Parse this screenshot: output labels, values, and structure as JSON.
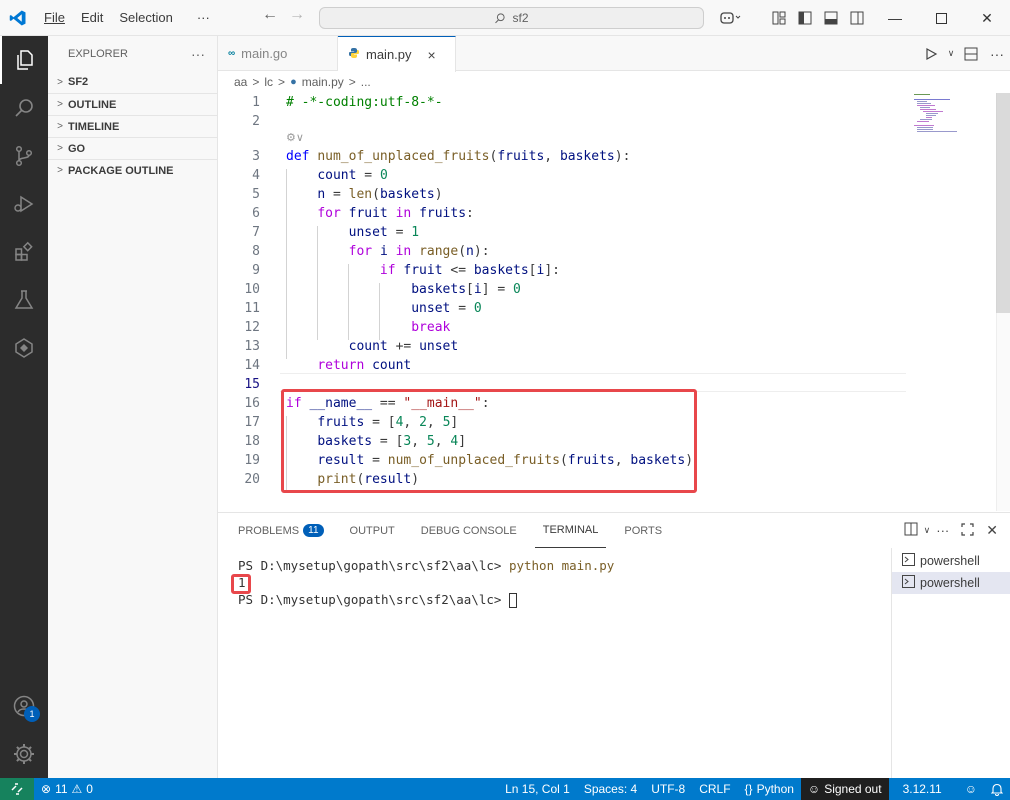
{
  "titlebar": {
    "menu": [
      "File",
      "Edit",
      "Selection"
    ],
    "more": "···",
    "search_text": "sf2"
  },
  "sidebar": {
    "title": "EXPLORER",
    "more": "···",
    "sections": [
      "SF2",
      "OUTLINE",
      "TIMELINE",
      "GO",
      "PACKAGE OUTLINE"
    ]
  },
  "tabs": [
    {
      "label": "main.go",
      "active": false
    },
    {
      "label": "main.py",
      "active": true,
      "close": "×"
    }
  ],
  "breadcrumb": [
    "aa",
    "lc",
    "main.py",
    "..."
  ],
  "editor": {
    "current_line": 15,
    "lines": [
      {
        "n": "1",
        "text": "# -*-coding:utf-8-*-"
      },
      {
        "n": "2",
        "text": ""
      },
      {
        "n": "3",
        "text": "def num_of_unplaced_fruits(fruits, baskets):"
      },
      {
        "n": "4",
        "text": "    count = 0"
      },
      {
        "n": "5",
        "text": "    n = len(baskets)"
      },
      {
        "n": "6",
        "text": "    for fruit in fruits:"
      },
      {
        "n": "7",
        "text": "        unset = 1"
      },
      {
        "n": "8",
        "text": "        for i in range(n):"
      },
      {
        "n": "9",
        "text": "            if fruit <= baskets[i]:"
      },
      {
        "n": "10",
        "text": "                baskets[i] = 0"
      },
      {
        "n": "11",
        "text": "                unset = 0"
      },
      {
        "n": "12",
        "text": "                break"
      },
      {
        "n": "13",
        "text": "        count += unset"
      },
      {
        "n": "14",
        "text": "    return count"
      },
      {
        "n": "15",
        "text": ""
      },
      {
        "n": "16",
        "text": "if __name__ == \"__main__\":"
      },
      {
        "n": "17",
        "text": "    fruits = [4, 2, 5]"
      },
      {
        "n": "18",
        "text": "    baskets = [3, 5, 4]"
      },
      {
        "n": "19",
        "text": "    result = num_of_unplaced_fruits(fruits, baskets)"
      },
      {
        "n": "20",
        "text": "    print(result)"
      }
    ]
  },
  "panel": {
    "tabs": [
      {
        "label": "PROBLEMS",
        "badge": "11"
      },
      {
        "label": "OUTPUT"
      },
      {
        "label": "DEBUG CONSOLE"
      },
      {
        "label": "TERMINAL",
        "active": true
      },
      {
        "label": "PORTS"
      }
    ],
    "terminal": {
      "line1_prompt": "PS D:\\mysetup\\gopath\\src\\sf2\\aa\\lc> ",
      "line1_cmd": "python main.py",
      "output": "1",
      "line3_prompt": "PS D:\\mysetup\\gopath\\src\\sf2\\aa\\lc> "
    },
    "terminals": [
      "powershell",
      "powershell"
    ]
  },
  "accounts_badge": "1",
  "statusbar": {
    "errors": "11",
    "warnings": "0",
    "position": "Ln 15, Col 1",
    "spaces": "Spaces: 4",
    "encoding": "UTF-8",
    "eol": "CRLF",
    "language": "Python",
    "signed": "Signed out",
    "version": "3.12.11"
  },
  "colors": {
    "accent": "#005fb8",
    "statusbar": "#007acc",
    "highlight_box": "#e8474b"
  }
}
